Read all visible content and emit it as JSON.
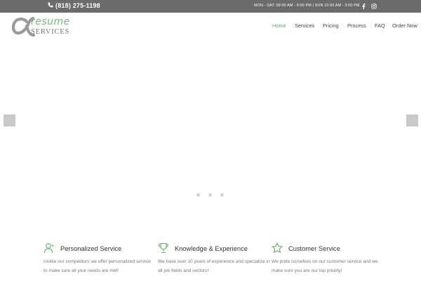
{
  "topbar": {
    "phone": "(818) 275-1198",
    "hours": "MON - SAT: 09:00 AM - 6:00 PM | SUN 10:00 AM - 3:00 PM",
    "social": [
      "facebook-icon",
      "instagram-icon"
    ]
  },
  "header": {
    "logo": {
      "top": "resume",
      "bottom": "SERVICES"
    },
    "nav": [
      {
        "label": "Home",
        "active": true
      },
      {
        "label": "Services",
        "active": false
      },
      {
        "label": "Pricing",
        "active": false
      },
      {
        "label": "Process",
        "active": false
      },
      {
        "label": "FAQ",
        "active": false
      },
      {
        "label": "Order Now",
        "active": false
      }
    ]
  },
  "slider": {
    "slides": 3,
    "current": 2
  },
  "features": [
    {
      "icon": "person-icon",
      "title": "Personalized Service",
      "text": "Unlike our competitors we offer personalized service to make sure all your needs are met!"
    },
    {
      "icon": "trophy-icon",
      "title": "Knowledge & Experience",
      "text": "We have over 10 years of experience and specialize in all job fields and sectors!"
    },
    {
      "icon": "star-icon",
      "title": "Customer Service",
      "text": "We pride ourselves on our customer service and we make sure you are our top priority!"
    }
  ],
  "colors": {
    "accent": "#5cb85c",
    "topbar": "#6b6b6b",
    "logo_green": "#78b77e"
  }
}
